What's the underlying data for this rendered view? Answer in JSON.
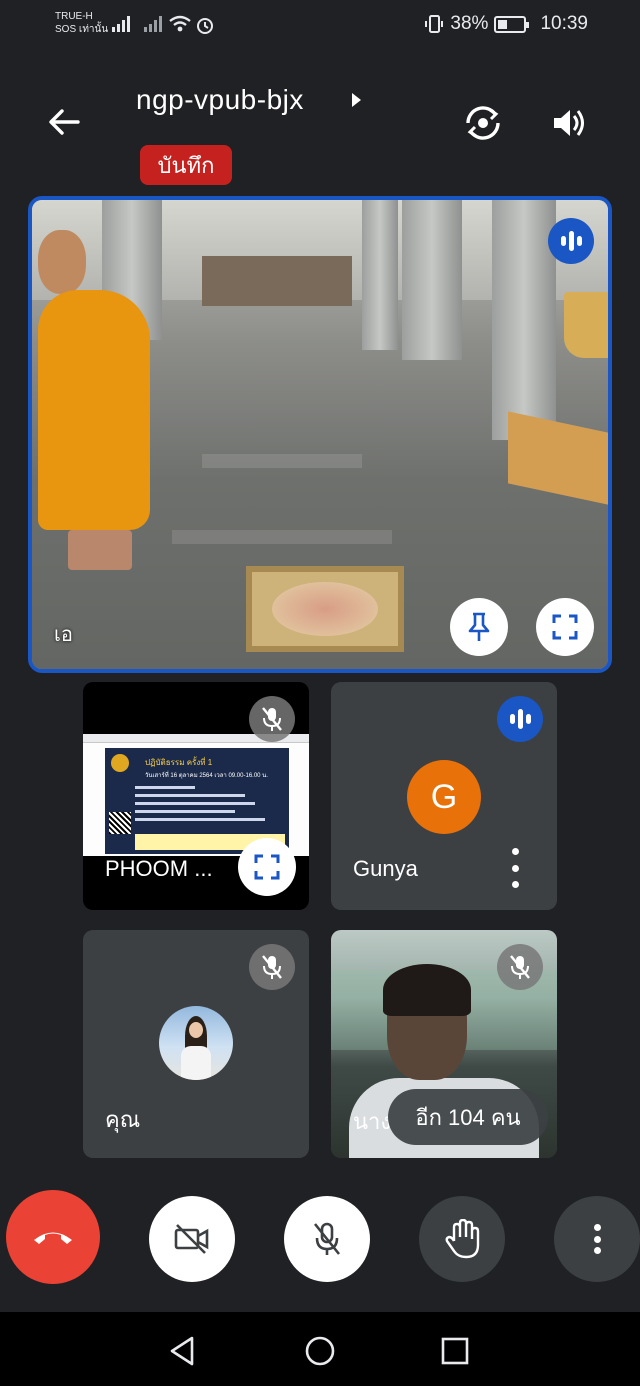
{
  "status_bar": {
    "carrier_line1": "TRUE-H",
    "carrier_line2": "SOS เท่านั้น",
    "battery": "38%",
    "time": "10:39"
  },
  "header": {
    "meeting_code": "ngp-vpub-bjx",
    "recording_label": "บันทึก"
  },
  "main_tile": {
    "name": "เอ",
    "speaking": true
  },
  "tiles": [
    {
      "name": "PHOOM  ...",
      "muted": true,
      "presenting": true,
      "screen": {
        "heading": "ปฏิบัติธรรม ครั้งที่ 1",
        "subheading": "วันเสาร์ที่ 16 ตุลาคม 2564 เวลา 09.00-16.00 น."
      }
    },
    {
      "name": "Gunya",
      "avatar_letter": "G",
      "avatar_color": "#e8710a",
      "speaking": true
    },
    {
      "name": "คุณ",
      "muted": true
    },
    {
      "name": "นาง",
      "muted": true
    }
  ],
  "more_participants": "อีก 104 คน",
  "controls": [
    "end-call",
    "camera-off",
    "mic-off",
    "raise-hand",
    "more-options"
  ],
  "colors": {
    "background": "#202124",
    "accent_blue": "#1a56c4",
    "end_call_red": "#ea4335",
    "record_red": "#c5221f"
  }
}
